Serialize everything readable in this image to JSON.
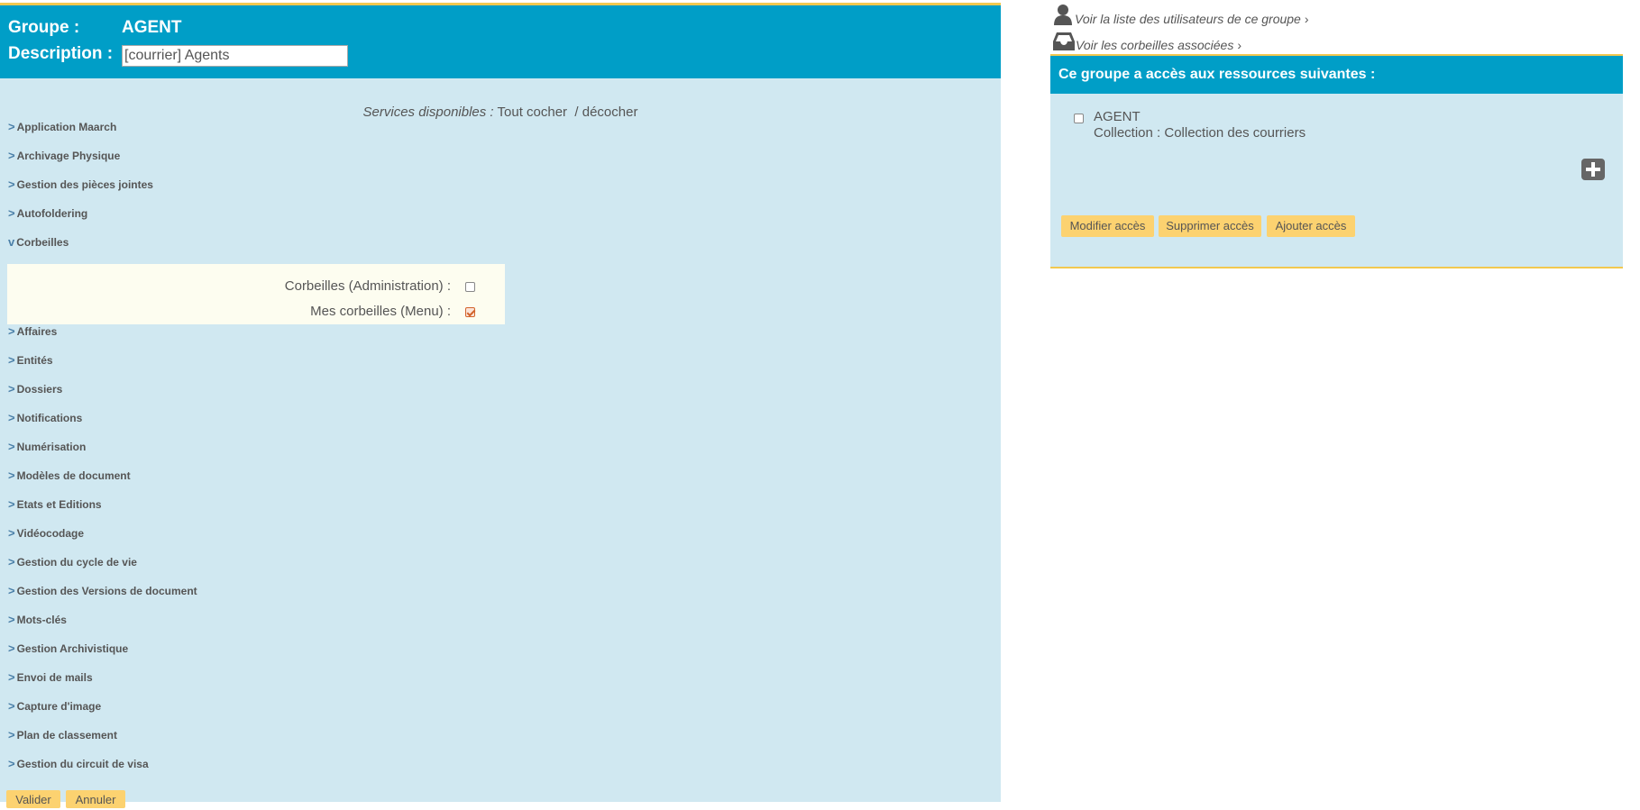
{
  "group": {
    "label": "Groupe :",
    "name": "AGENT",
    "description_label": "Description :",
    "description_value": "[courrier] Agents"
  },
  "services": {
    "label": "Services disponibles :",
    "check_all": "Tout cocher",
    "separator": "/",
    "uncheck": "décocher",
    "items": [
      {
        "label": "Application Maarch",
        "expanded": false
      },
      {
        "label": "Archivage Physique",
        "expanded": false
      },
      {
        "label": "Gestion des pièces jointes",
        "expanded": false
      },
      {
        "label": "Autofoldering",
        "expanded": false
      },
      {
        "label": "Corbeilles",
        "expanded": true
      },
      {
        "label": "Affaires",
        "expanded": false
      },
      {
        "label": "Entités",
        "expanded": false
      },
      {
        "label": "Dossiers",
        "expanded": false
      },
      {
        "label": "Notifications",
        "expanded": false
      },
      {
        "label": "Numérisation",
        "expanded": false
      },
      {
        "label": "Modèles de document",
        "expanded": false
      },
      {
        "label": "Etats et Editions",
        "expanded": false
      },
      {
        "label": "Vidéocodage",
        "expanded": false
      },
      {
        "label": "Gestion du cycle de vie",
        "expanded": false
      },
      {
        "label": "Gestion des Versions de document",
        "expanded": false
      },
      {
        "label": "Mots-clés",
        "expanded": false
      },
      {
        "label": "Gestion Archivistique",
        "expanded": false
      },
      {
        "label": "Envoi de mails",
        "expanded": false
      },
      {
        "label": "Capture d'image",
        "expanded": false
      },
      {
        "label": "Plan de classement",
        "expanded": false
      },
      {
        "label": "Gestion du circuit de visa",
        "expanded": false
      }
    ],
    "corbeilles_options": [
      {
        "label": "Corbeilles (Administration) :",
        "checked": false
      },
      {
        "label": "Mes corbeilles (Menu) :",
        "checked": true
      }
    ]
  },
  "form_buttons": {
    "validate": "Valider",
    "cancel": "Annuler"
  },
  "links": {
    "users": "Voir la liste des utilisateurs de ce groupe",
    "baskets": "Voir les corbeilles associées",
    "arrow": "›"
  },
  "access": {
    "title": "Ce groupe a accès aux ressources suivantes :",
    "resources": [
      {
        "name": "AGENT",
        "collection": "Collection : Collection des courriers",
        "checked": false
      }
    ],
    "buttons": {
      "modify": "Modifier accès",
      "delete": "Supprimer accès",
      "add": "Ajouter accès"
    }
  },
  "colors": {
    "header_blue": "#009ec7",
    "panel_bg": "#d0e8f1",
    "button_yellow": "#fcd270",
    "accent_border": "#f2c850"
  }
}
